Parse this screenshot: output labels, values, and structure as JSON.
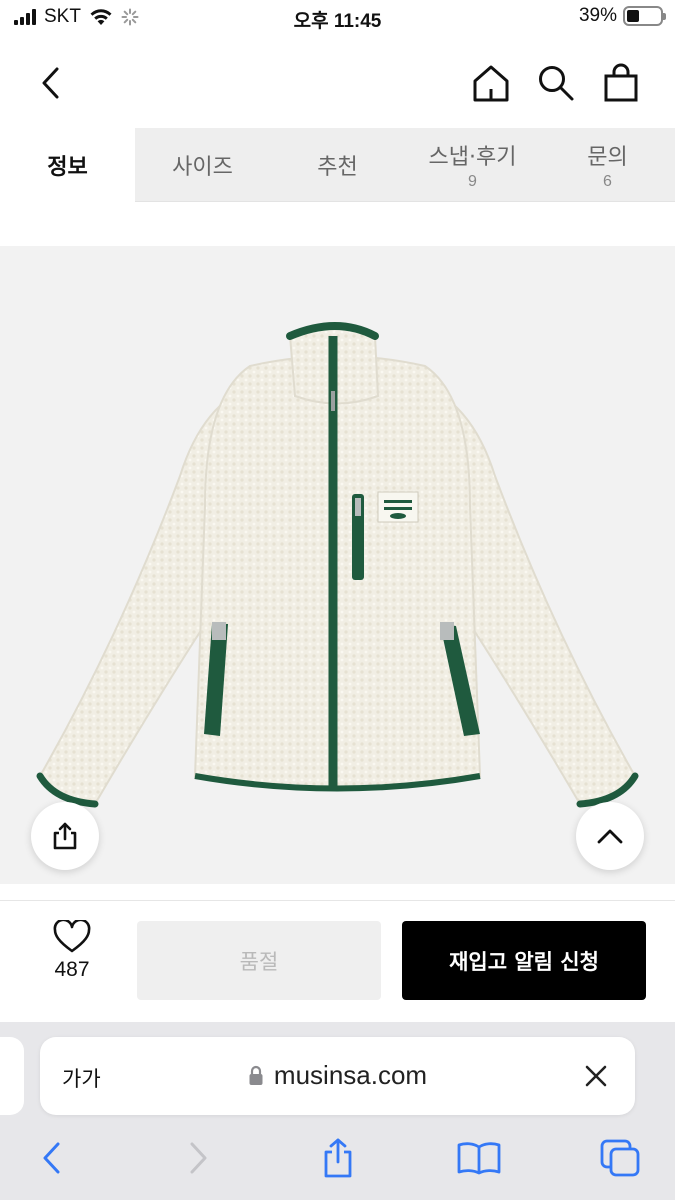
{
  "status_bar": {
    "carrier": "SKT",
    "time": "오후 11:45",
    "battery": "39%",
    "battery_level": 0.39
  },
  "tabs": [
    {
      "label": "정보",
      "count": "",
      "active": true
    },
    {
      "label": "사이즈",
      "count": "",
      "active": false
    },
    {
      "label": "추천",
      "count": "",
      "active": false
    },
    {
      "label": "스냅·후기",
      "count": "9",
      "active": false
    },
    {
      "label": "문의",
      "count": "6",
      "active": false
    }
  ],
  "product": {
    "image": "white fleece jacket with green zipper trim",
    "colors": {
      "fleece": "#f1eee4",
      "trim": "#1f5a3e",
      "background": "#f2f2f2"
    }
  },
  "purchase_bar": {
    "like_count": "487",
    "soldout_label": "품절",
    "restock_label": "재입고 알림 신청"
  },
  "safari": {
    "aa_label": "가가",
    "url": "musinsa.com"
  },
  "icons": {
    "back": "chevron-left-icon",
    "home": "home-icon",
    "search": "search-icon",
    "cart": "bag-icon",
    "share": "share-icon",
    "scroll_top": "chevron-up-icon",
    "like": "heart-icon",
    "lock": "lock-icon",
    "clear": "close-icon"
  },
  "colors": {
    "accent_blue": "#3478f6",
    "black": "#000000"
  }
}
